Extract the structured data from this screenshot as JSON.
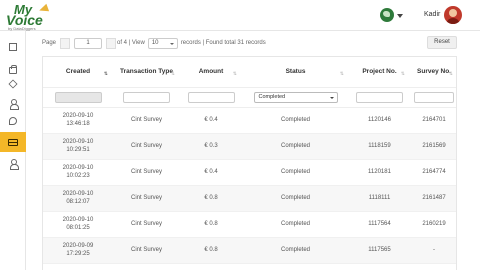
{
  "brand": {
    "line1": "My",
    "line2": "Voice",
    "line3": "by DataDiggers"
  },
  "header": {
    "username": "Kadir",
    "language_icon": "globe-icon",
    "avatar_icon": "avatar"
  },
  "sidebar": {
    "items": [
      {
        "icon": "document-icon",
        "active": false
      },
      {
        "icon": "shopping-bag-icon",
        "active": false
      },
      {
        "icon": "layers-icon",
        "active": false
      },
      {
        "icon": "users-icon",
        "active": false
      },
      {
        "icon": "tag-icon",
        "active": false
      },
      {
        "icon": "payment-card-icon",
        "active": true
      },
      {
        "icon": "profile-icon",
        "active": false
      }
    ],
    "active_color": "#f4b728"
  },
  "pager": {
    "page_label": "Page",
    "page_value": "1",
    "of_label": "of 4 | View",
    "view_value": "10",
    "records_text": "records | Found total 31 records",
    "reset_label": "Reset"
  },
  "table": {
    "columns": [
      "Created",
      "Transaction Type",
      "Amount",
      "Status",
      "Project No.",
      "Survey No."
    ],
    "status_filter": "Completed",
    "rows": [
      {
        "created_date": "2020-09-10",
        "created_time": "13:46:18",
        "type": "Cint Survey",
        "amount": "€ 0.4",
        "status": "Completed",
        "project": "1120146",
        "survey": "2164701"
      },
      {
        "created_date": "2020-09-10",
        "created_time": "10:29:51",
        "type": "Cint Survey",
        "amount": "€ 0.3",
        "status": "Completed",
        "project": "1118159",
        "survey": "2161569"
      },
      {
        "created_date": "2020-09-10",
        "created_time": "10:02:23",
        "type": "Cint Survey",
        "amount": "€ 0.4",
        "status": "Completed",
        "project": "1120181",
        "survey": "2164774"
      },
      {
        "created_date": "2020-09-10",
        "created_time": "08:12:07",
        "type": "Cint Survey",
        "amount": "€ 0.8",
        "status": "Completed",
        "project": "1118111",
        "survey": "2161487"
      },
      {
        "created_date": "2020-09-10",
        "created_time": "08:01:25",
        "type": "Cint Survey",
        "amount": "€ 0.8",
        "status": "Completed",
        "project": "1117564",
        "survey": "2160219"
      },
      {
        "created_date": "2020-09-09",
        "created_time": "17:29:25",
        "type": "Cint Survey",
        "amount": "€ 0.8",
        "status": "Completed",
        "project": "1117565",
        "survey": "-"
      }
    ]
  }
}
